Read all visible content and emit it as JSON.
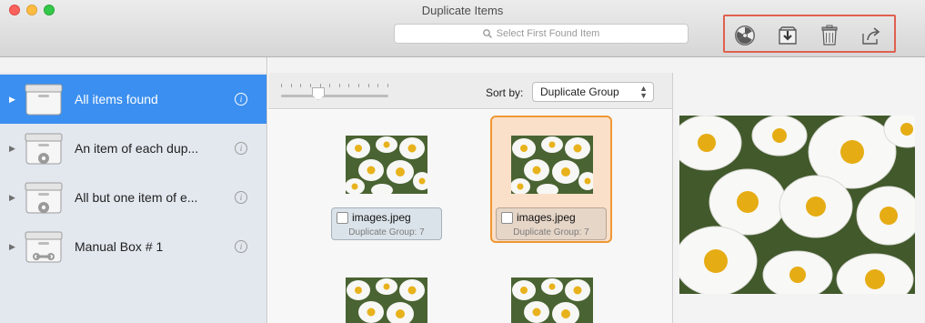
{
  "window": {
    "title": "Duplicate Items"
  },
  "toolbar": {
    "search_placeholder": "Select First Found Item",
    "actions": [
      {
        "name": "radiation-icon"
      },
      {
        "name": "import-icon"
      },
      {
        "name": "trash-icon"
      },
      {
        "name": "share-icon"
      }
    ],
    "highlight_color": "#e0604f"
  },
  "sidebar": {
    "items": [
      {
        "label": "All items found",
        "selected": true,
        "icon": "box-icon"
      },
      {
        "label": "An item of each dup...",
        "selected": false,
        "icon": "box-gear-icon"
      },
      {
        "label": "All but one item of e...",
        "selected": false,
        "icon": "box-gear-icon"
      },
      {
        "label": "Manual Box # 1",
        "selected": false,
        "icon": "box-wrench-icon"
      }
    ],
    "info_glyph": "i",
    "selection_color": "#3b8ff0"
  },
  "main": {
    "sort_label": "Sort by:",
    "sort_value": "Duplicate Group",
    "items": [
      {
        "file_name": "images.jpeg",
        "group": "Duplicate Group: 7",
        "selected": false
      },
      {
        "file_name": "images.jpeg",
        "group": "Duplicate Group: 7",
        "selected": true
      }
    ],
    "selected_color": "#ef9734"
  }
}
